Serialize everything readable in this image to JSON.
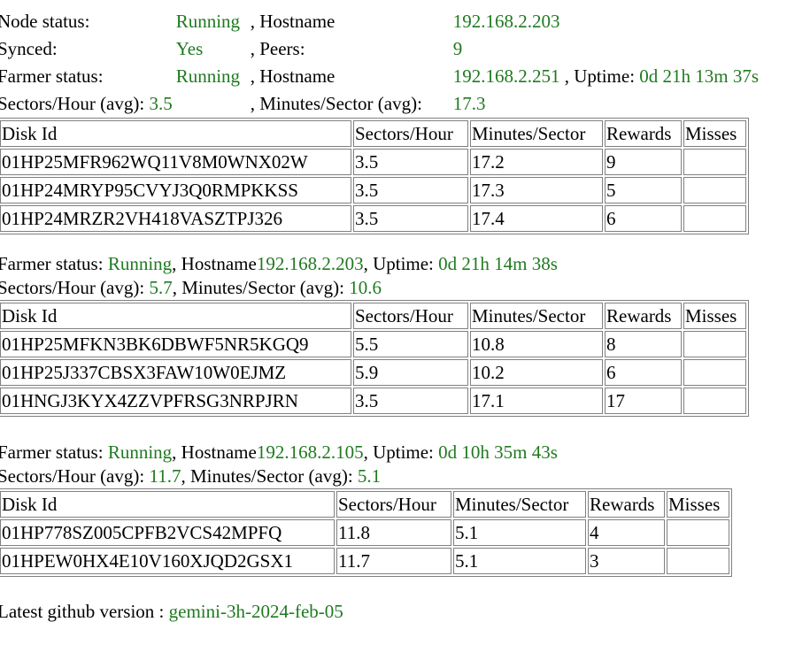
{
  "node": {
    "status_label": "Node status:",
    "status": "Running",
    "hostname_label": ", Hostname",
    "hostname": "192.168.2.203",
    "synced_label": "Synced:",
    "synced": "Yes",
    "peers_label": ", Peers:",
    "peers": "9"
  },
  "farmer1": {
    "status_label": "Farmer status:",
    "status": "Running",
    "hostname_label": ", Hostname",
    "hostname": "192.168.2.251",
    "uptime_label": ", Uptime:",
    "uptime": "0d 21h 13m 37s",
    "sph_label": "Sectors/Hour (avg):",
    "sph": "3.5",
    "mps_label": ", Minutes/Sector (avg):",
    "mps": "17.3",
    "columns": [
      "Disk Id",
      "Sectors/Hour",
      "Minutes/Sector",
      "Rewards",
      "Misses"
    ],
    "rows": [
      {
        "id": "01HP25MFR962WQ11V8M0WNX02W",
        "sph": "3.5",
        "mps": "17.2",
        "rewards": "9",
        "misses": ""
      },
      {
        "id": "01HP24MRYP95CVYJ3Q0RMPKKSS",
        "sph": "3.5",
        "mps": "17.3",
        "rewards": "5",
        "misses": ""
      },
      {
        "id": "01HP24MRZR2VH418VASZTPJ326",
        "sph": "3.5",
        "mps": "17.4",
        "rewards": "6",
        "misses": ""
      }
    ]
  },
  "farmer2": {
    "status_label": "Farmer status: ",
    "status": "Running",
    "hostname_label": ", Hostname",
    "hostname": "192.168.2.203",
    "uptime_label": ", Uptime: ",
    "uptime": "0d 21h 14m 38s",
    "sph_label": "Sectors/Hour (avg): ",
    "sph": "5.7",
    "mps_label": ", Minutes/Sector (avg): ",
    "mps": "10.6",
    "columns": [
      "Disk Id",
      "Sectors/Hour",
      "Minutes/Sector",
      "Rewards",
      "Misses"
    ],
    "rows": [
      {
        "id": "01HP25MFKN3BK6DBWF5NR5KGQ9",
        "sph": "5.5",
        "mps": "10.8",
        "rewards": "8",
        "misses": ""
      },
      {
        "id": "01HP25J337CBSX3FAW10W0EJMZ",
        "sph": "5.9",
        "mps": "10.2",
        "rewards": "6",
        "misses": ""
      },
      {
        "id": "01HNGJ3KYX4ZZVPFRSG3NRPJRN",
        "sph": "3.5",
        "mps": "17.1",
        "rewards": "17",
        "misses": ""
      }
    ]
  },
  "farmer3": {
    "status_label": "Farmer status: ",
    "status": "Running",
    "hostname_label": ", Hostname",
    "hostname": "192.168.2.105",
    "uptime_label": ", Uptime: ",
    "uptime": "0d 10h 35m 43s",
    "sph_label": "Sectors/Hour (avg): ",
    "sph": "11.7",
    "mps_label": ", Minutes/Sector (avg): ",
    "mps": "5.1",
    "columns": [
      "Disk Id",
      "Sectors/Hour",
      "Minutes/Sector",
      "Rewards",
      "Misses"
    ],
    "rows": [
      {
        "id": "01HP778SZ005CPFB2VCS42MPFQ",
        "sph": "11.8",
        "mps": "5.1",
        "rewards": "4",
        "misses": ""
      },
      {
        "id": "01HPEW0HX4E10V160XJQD2GSX1",
        "sph": "11.7",
        "mps": "5.1",
        "rewards": "3",
        "misses": ""
      }
    ]
  },
  "footer": {
    "label": "Latest github version : ",
    "version": "gemini-3h-2024-feb-05"
  },
  "colors": {
    "value_green": "#1f7a1f",
    "border_gray": "#808080"
  }
}
